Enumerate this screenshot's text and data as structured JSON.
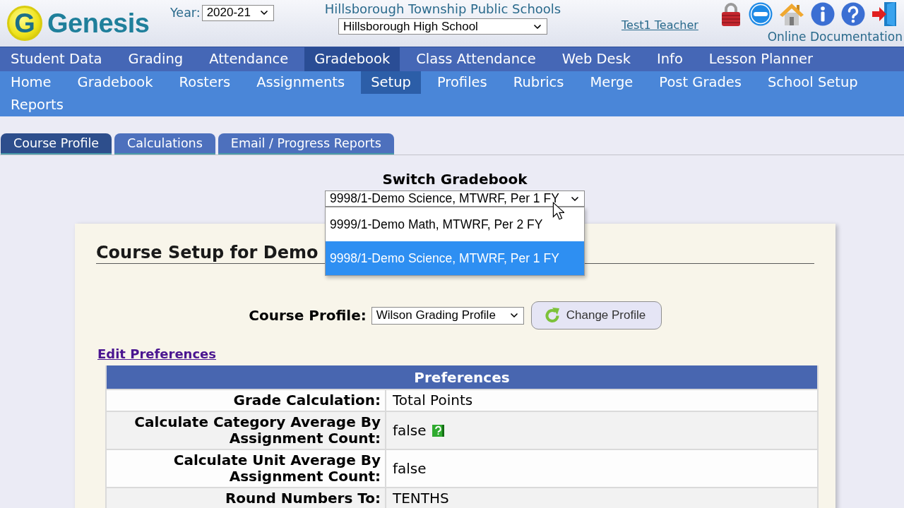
{
  "header": {
    "logo": {
      "mark": "G",
      "name": "Genesis"
    },
    "year": {
      "label": "Year:",
      "value": "2020-21"
    },
    "district": "Hillsborough Township Public Schools",
    "school": {
      "value": "Hillsborough High School"
    },
    "user": "Test1 Teacher",
    "toolbar": [
      {
        "kind": "lock"
      },
      {
        "kind": "minus"
      },
      {
        "kind": "home"
      },
      {
        "kind": "info"
      },
      {
        "kind": "help"
      },
      {
        "kind": "exit"
      }
    ],
    "documentation_link": "Online Documentation"
  },
  "main_nav": [
    {
      "label": "Student Data",
      "selected": false
    },
    {
      "label": "Grading",
      "selected": false
    },
    {
      "label": "Attendance",
      "selected": false
    },
    {
      "label": "Gradebook",
      "selected": true
    },
    {
      "label": "Class Attendance",
      "selected": false
    },
    {
      "label": "Web Desk",
      "selected": false
    },
    {
      "label": "Info",
      "selected": false
    },
    {
      "label": "Lesson Planner",
      "selected": false
    }
  ],
  "sub_nav": [
    {
      "label": "Home",
      "selected": false
    },
    {
      "label": "Gradebook",
      "selected": false
    },
    {
      "label": "Rosters",
      "selected": false
    },
    {
      "label": "Assignments",
      "selected": false
    },
    {
      "label": "Setup",
      "selected": true
    },
    {
      "label": "Profiles",
      "selected": false
    },
    {
      "label": "Rubrics",
      "selected": false
    },
    {
      "label": "Merge",
      "selected": false
    },
    {
      "label": "Post Grades",
      "selected": false
    },
    {
      "label": "School Setup",
      "selected": false
    },
    {
      "label": "Reports",
      "selected": false
    }
  ],
  "tabs": [
    {
      "label": "Course Profile",
      "selected": true
    },
    {
      "label": "Calculations",
      "selected": false
    },
    {
      "label": "Email / Progress Reports",
      "selected": false
    }
  ],
  "switch_gradebook": {
    "title": "Switch Gradebook",
    "value": "9998/1-Demo Science, MTWRF, Per 1 FY",
    "expanded": true,
    "options": [
      {
        "label": "9999/1-Demo Math, MTWRF, Per 2 FY",
        "selected": false
      },
      {
        "label": "9998/1-Demo Science, MTWRF, Per 1 FY",
        "selected": true
      }
    ]
  },
  "course_setup": {
    "title": "Course Setup for Demo",
    "profile": {
      "label": "Course Profile:",
      "value": "Wilson Grading Profile",
      "button": "Change Profile"
    },
    "edit_link": "Edit Preferences",
    "preferences": {
      "title": "Preferences",
      "rows": [
        {
          "label": "Grade Calculation:",
          "value": "Total Points",
          "help": false
        },
        {
          "label": "Calculate Category Average By Assignment Count:",
          "value": "false",
          "help": true
        },
        {
          "label": "Calculate Unit Average By Assignment Count:",
          "value": "false",
          "help": false
        },
        {
          "label": "Round Numbers To:",
          "value": "TENTHS",
          "help": false
        }
      ]
    }
  }
}
